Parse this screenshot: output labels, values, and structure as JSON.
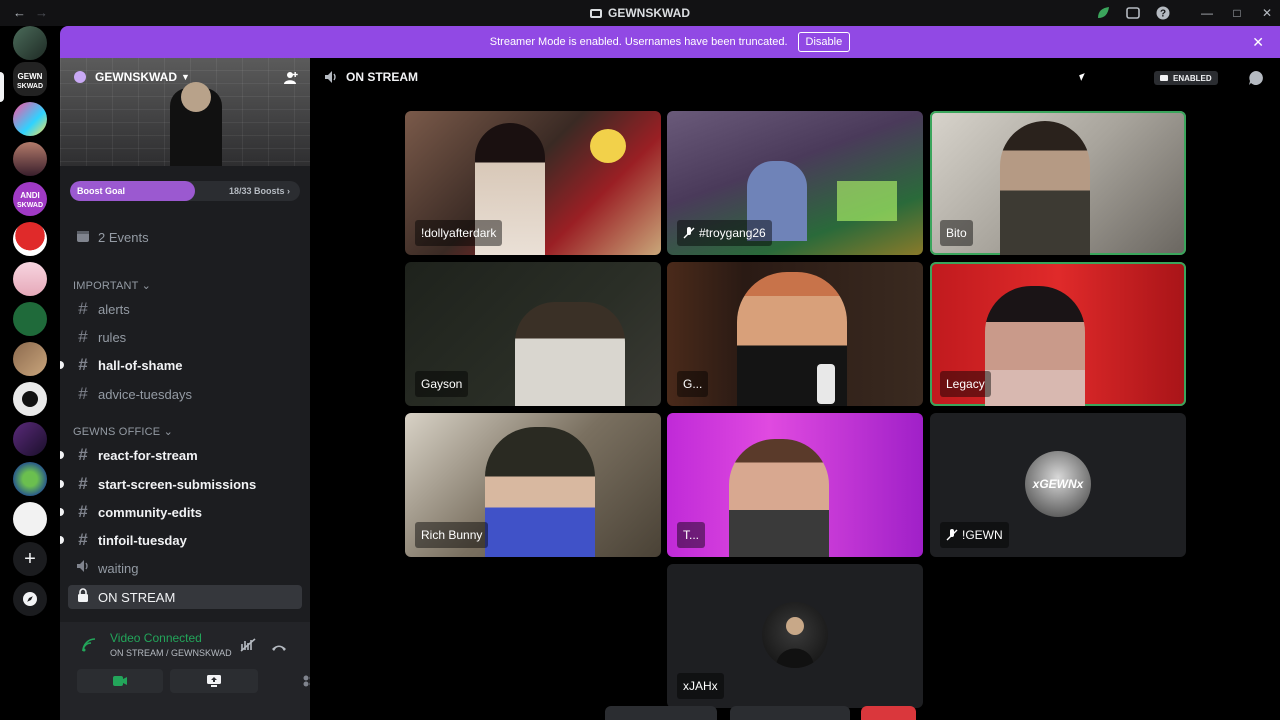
{
  "window": {
    "title": "GEWNSKWAD"
  },
  "banner": {
    "text": "Streamer Mode is enabled. Usernames have been truncated.",
    "button": "Disable"
  },
  "guild": {
    "name": "GEWNSKWAD"
  },
  "boost": {
    "label": "Boost Goal",
    "count": "18/33 Boosts",
    "progress": 0.545
  },
  "events": {
    "label": "2 Events"
  },
  "categories": {
    "important": "IMPORTANT",
    "office": "GEWNS OFFICE"
  },
  "channels": {
    "alerts": "alerts",
    "rules": "rules",
    "hall_of_shame": "hall-of-shame",
    "advice_tuesdays": "advice-tuesdays",
    "react_for_stream": "react-for-stream",
    "start_screen": "start-screen-submissions",
    "community_edits": "community-edits",
    "tinfoil_tuesday": "tinfoil-tuesday",
    "waiting": "waiting",
    "on_stream": "ON STREAM"
  },
  "voice": {
    "status": "Video Connected",
    "location": "ON STREAM / GEWNSKWAD"
  },
  "stage": {
    "title": "ON STREAM",
    "badge": "ENABLED"
  },
  "participants": {
    "p1": "!dollyafterdark",
    "p2": "#troygang26",
    "p3": "Bito",
    "p4": "Gayson",
    "p5": "G...",
    "p6": "Legacy",
    "p7": "Rich Bunny",
    "p8": "T...",
    "p9": "!GEWN",
    "p10": "xJAHx"
  },
  "avatar_text": {
    "gewn": "xGEWNx"
  },
  "colors": {
    "accent": "#9149e4",
    "speaking": "#3ba55c",
    "connected": "#23a55a",
    "sidebar": "#1c1d20"
  }
}
